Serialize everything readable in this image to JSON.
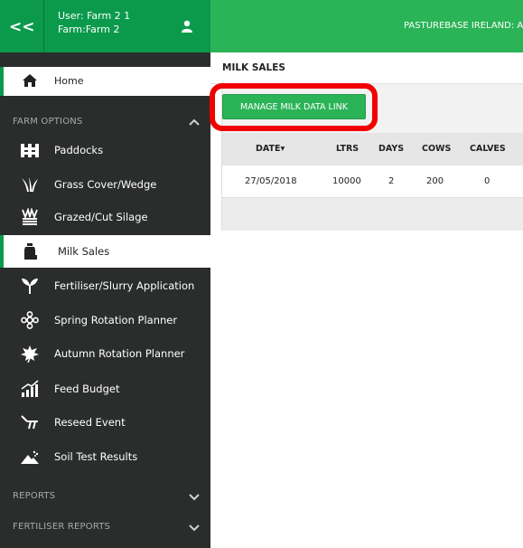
{
  "header": {
    "collapse_label": "<<",
    "user_line1": "User: Farm 2 1",
    "user_line2": "Farm:Farm 2",
    "app_title": "PASTUREBASE IRELAND: A"
  },
  "sidebar": {
    "home_label": "Home",
    "sections": {
      "farm_options": "FARM OPTIONS",
      "reports": "REPORTS",
      "fertiliser_reports": "FERTILISER REPORTS"
    },
    "items": [
      {
        "label": "Paddocks",
        "icon": "paddocks-icon"
      },
      {
        "label": "Grass Cover/Wedge",
        "icon": "grass-icon"
      },
      {
        "label": "Grazed/Cut Silage",
        "icon": "silage-icon"
      },
      {
        "label": "Milk Sales",
        "icon": "milk-can-icon"
      },
      {
        "label": "Fertiliser/Slurry Application",
        "icon": "sprout-icon"
      },
      {
        "label": "Spring Rotation Planner",
        "icon": "flower-icon"
      },
      {
        "label": "Autumn Rotation Planner",
        "icon": "leaf-icon"
      },
      {
        "label": "Feed Budget",
        "icon": "chart-icon"
      },
      {
        "label": "Reseed Event",
        "icon": "plough-icon"
      },
      {
        "label": "Soil Test Results",
        "icon": "soil-icon"
      }
    ]
  },
  "main": {
    "page_title": "MILK SALES",
    "manage_button": "MANAGE MILK DATA LINK",
    "table": {
      "columns": [
        "DATE",
        "LTRS",
        "DAYS",
        "COWS",
        "CALVES"
      ],
      "sort_indicator": "▾",
      "rows": [
        [
          "27/05/2018",
          "10000",
          "2",
          "200",
          "0"
        ]
      ]
    }
  },
  "colors": {
    "sidebar_bg": "#2a2d2b",
    "brand_green": "#0b9a4c",
    "topbar_green": "#2bb357",
    "highlight_red": "#f00000"
  }
}
